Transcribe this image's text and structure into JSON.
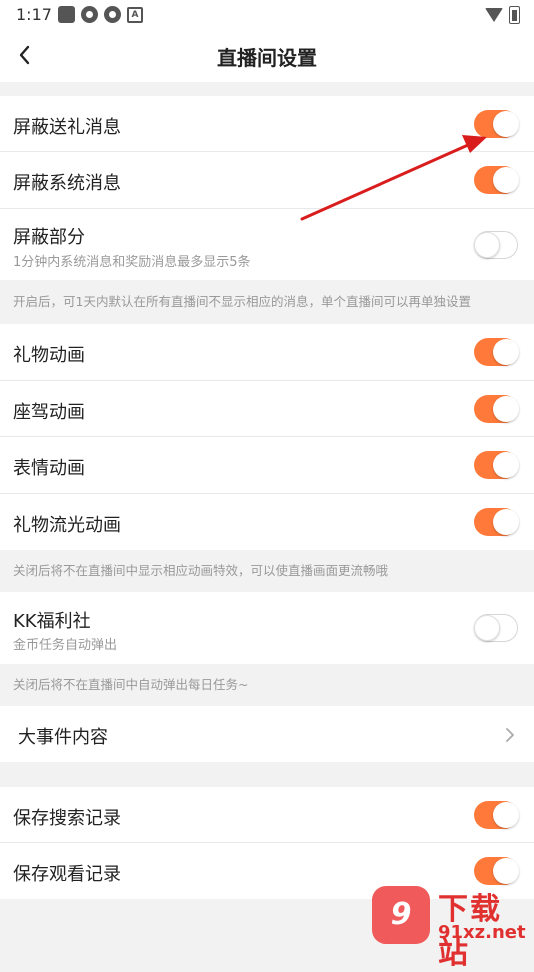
{
  "status_bar": {
    "time": "1:17",
    "app_icon_label": "A"
  },
  "header": {
    "title": "直播间设置"
  },
  "section1": {
    "items": [
      {
        "label": "屏蔽送礼消息",
        "on": true
      },
      {
        "label": "屏蔽系统消息",
        "on": true
      },
      {
        "label": "屏蔽部分",
        "sub": "1分钟内系统消息和奖励消息最多显示5条",
        "on": false
      }
    ],
    "note": "开启后，可1天内默认在所有直播间不显示相应的消息，单个直播间可以再单独设置"
  },
  "section2": {
    "items": [
      {
        "label": "礼物动画",
        "on": true
      },
      {
        "label": "座驾动画",
        "on": true
      },
      {
        "label": "表情动画",
        "on": true
      },
      {
        "label": "礼物流光动画",
        "on": true
      }
    ],
    "note": "关闭后将不在直播间中显示相应动画特效，可以使直播画面更流畅哦"
  },
  "section3": {
    "item": {
      "label": "KK福利社",
      "sub": "金币任务自动弹出",
      "on": false
    },
    "note": "关闭后将不在直播间中自动弹出每日任务~"
  },
  "section4": {
    "item": {
      "label": "大事件内容"
    }
  },
  "section5": {
    "items": [
      {
        "label": "保存搜索记录",
        "on": true
      },
      {
        "label": "保存观看记录",
        "on": true
      }
    ]
  },
  "watermark": {
    "badge": "9",
    "top": "下载站",
    "bottom": "91xz.net"
  },
  "colors": {
    "accent": "#ff7a3a",
    "annotation": "#d91c1c"
  },
  "icons": [
    "back-arrow-icon",
    "chevron-right-icon",
    "wifi-icon",
    "battery-icon"
  ]
}
